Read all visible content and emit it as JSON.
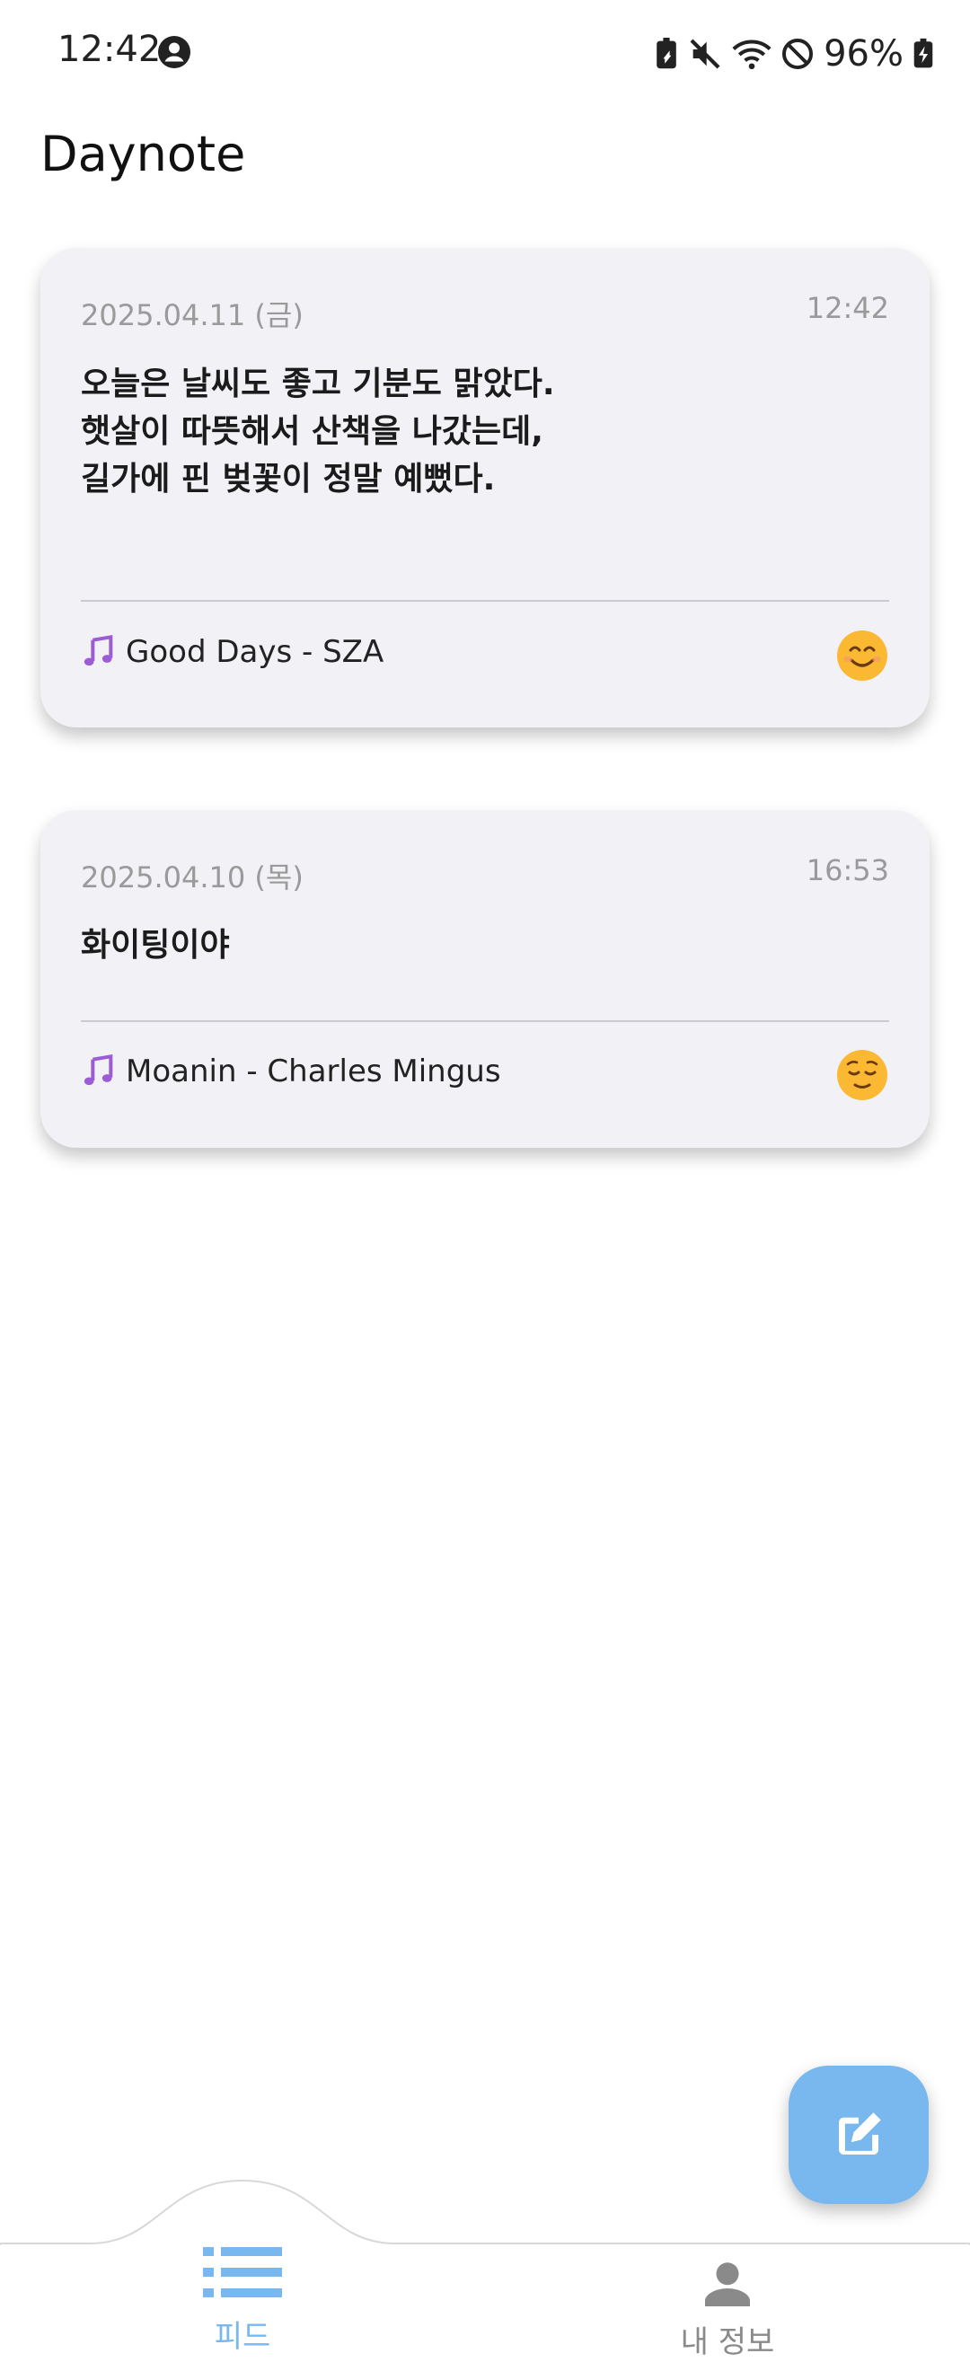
{
  "status_bar": {
    "time": "12:42",
    "battery_percent": "96%",
    "icons": [
      "account-circle-icon",
      "battery-saver-icon",
      "mute-icon",
      "wifi-icon",
      "do-not-disturb-icon",
      "battery-charging-icon"
    ]
  },
  "app": {
    "title": "Daynote"
  },
  "entries": [
    {
      "date": "2025.04.11 (금)",
      "time": "12:42",
      "text": "오늘은 날씨도 좋고 기분도 맑았다.\n햇살이 따뜻해서 산책을 나갔는데,\n길가에 핀 벚꽃이 정말 예뻤다.",
      "song": "Good Days - SZA",
      "mood": "smiling-face-icon"
    },
    {
      "date": "2025.04.10 (목)",
      "time": "16:53",
      "text": "화이팅이야",
      "song": "Moanin - Charles Mingus",
      "mood": "relieved-face-icon"
    }
  ],
  "fab": {
    "icon": "edit-icon"
  },
  "nav": {
    "feed_label": "피드",
    "profile_label": "내 정보",
    "active_color": "#78b8ee",
    "inactive_color": "#8a8a8a"
  }
}
